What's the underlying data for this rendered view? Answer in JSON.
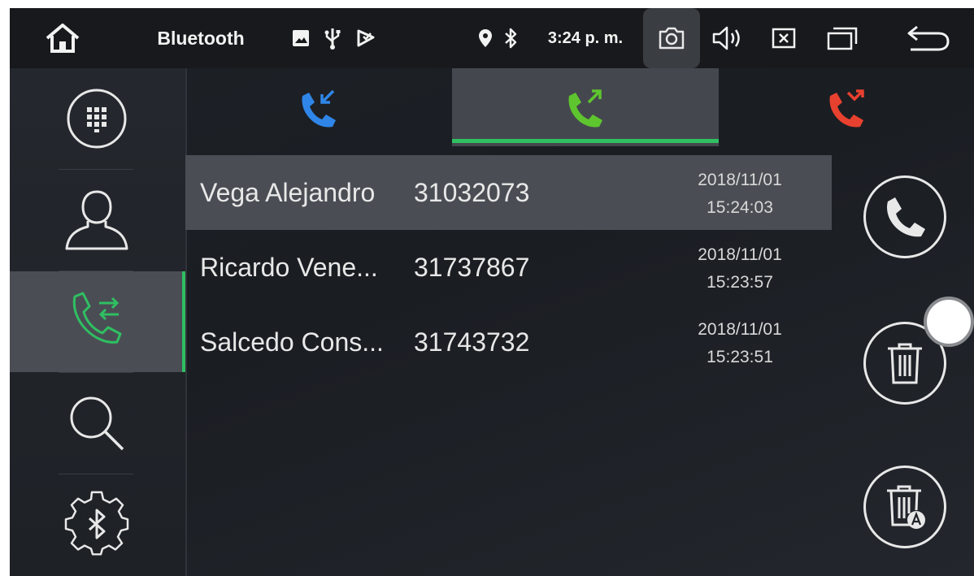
{
  "status_bar": {
    "title": "Bluetooth",
    "time": "3:24 p. m.",
    "icons": [
      "home-icon",
      "image-icon",
      "usb-icon",
      "signal-icon",
      "location-icon",
      "bluetooth-icon",
      "screenshot-icon",
      "volume-icon",
      "close-box-icon",
      "recent-apps-icon",
      "back-icon"
    ]
  },
  "left_nav": {
    "items": [
      "dialpad",
      "contacts",
      "call-log",
      "search",
      "bluetooth-settings"
    ],
    "active": "call-log"
  },
  "tabs": {
    "items": [
      "incoming-calls",
      "outgoing-calls",
      "missed-calls"
    ],
    "active": "outgoing-calls",
    "colors": {
      "incoming": "#2f86e8",
      "outgoing": "#5ec52e",
      "missed": "#e8412f",
      "accent": "#2fbf62"
    }
  },
  "call_log": [
    {
      "name": "Vega Alejandro",
      "number": "31032073",
      "date": "2018/11/01",
      "time": "15:24:03",
      "selected": true
    },
    {
      "name": "Ricardo Vene...",
      "number": "31737867",
      "date": "2018/11/01",
      "time": "15:23:57",
      "selected": false
    },
    {
      "name": "Salcedo Cons...",
      "number": "31743732",
      "date": "2018/11/01",
      "time": "15:23:51",
      "selected": false
    }
  ],
  "actions": [
    "call-button",
    "delete-button",
    "delete-all-button"
  ]
}
